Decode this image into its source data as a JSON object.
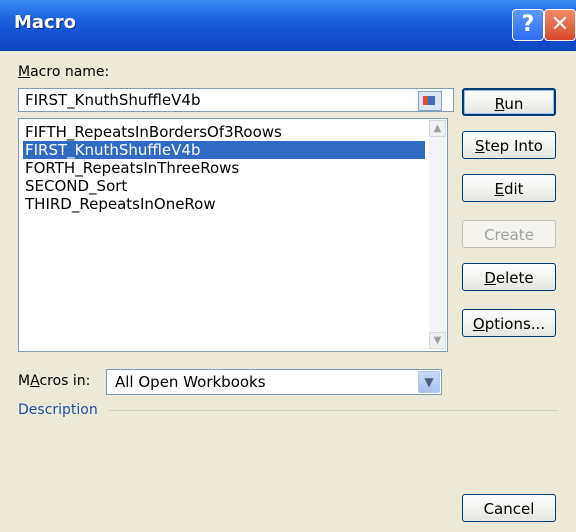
{
  "window": {
    "title": "Macro",
    "help_glyph": "?",
    "close_glyph": "✕"
  },
  "macro_name": {
    "label_prefix": "",
    "label_underlined": "M",
    "label_rest": "acro name:",
    "value": "FIRST_KnuthShuffleV4b",
    "picker_icon": "collapse-dialog-icon"
  },
  "macro_list": {
    "items": [
      "FIFTH_RepeatsInBordersOf3Roows",
      "FIRST_KnuthShuffleV4b",
      "FORTH_RepeatsInThreeRows",
      "SECOND_Sort",
      "THIRD_RepeatsInOneRow"
    ],
    "selected_index": 1,
    "scroll_up": "▲",
    "scroll_down": "▼"
  },
  "buttons": {
    "run": {
      "u": "R",
      "rest": "un"
    },
    "step_into": {
      "u": "S",
      "rest": "tep Into"
    },
    "edit": {
      "u": "E",
      "rest": "dit"
    },
    "create": {
      "label": "Create"
    },
    "delete": {
      "u": "D",
      "rest": "elete"
    },
    "options": {
      "u": "O",
      "rest": "ptions..."
    },
    "cancel": {
      "label": "Cancel"
    }
  },
  "macros_in": {
    "label_u": "A",
    "label_pre": "M",
    "label_rest": "cros in:",
    "value": "All Open Workbooks",
    "arrow": "▼"
  },
  "description": {
    "label": "Description"
  }
}
